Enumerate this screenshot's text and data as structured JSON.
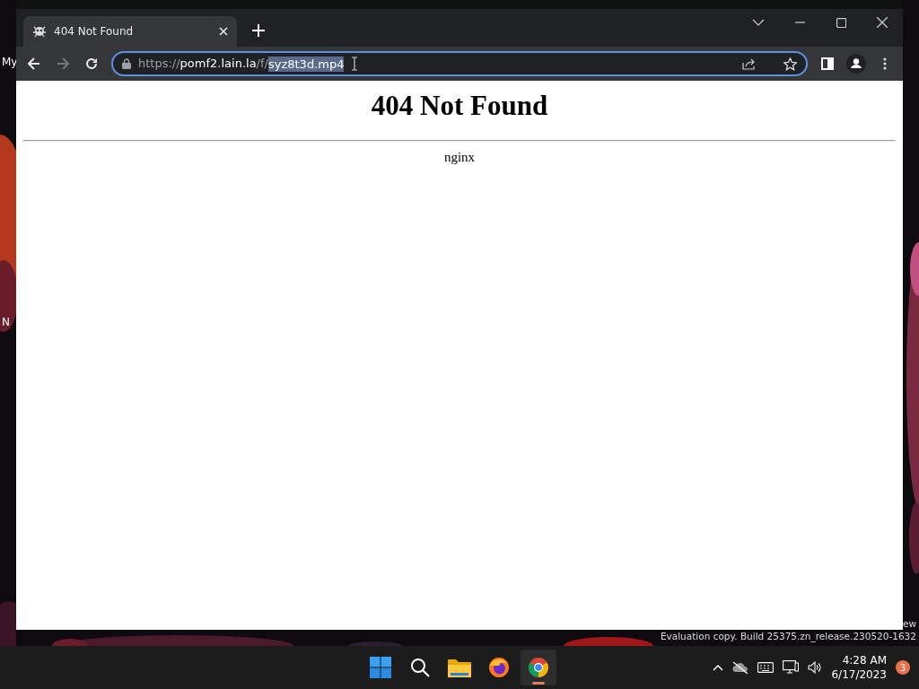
{
  "desktop": {
    "icon_labels": [
      {
        "text": "My"
      },
      {
        "text": "N"
      }
    ],
    "build_notice": {
      "line_1": "ew",
      "line_2": "Evaluation copy. Build 25375.zn_release.230520-1632"
    }
  },
  "browser": {
    "tabs": [
      {
        "title": "404 Not Found",
        "selected": true
      }
    ],
    "address": {
      "segments": [
        {
          "text": "https://",
          "kind": "dim",
          "selected": false
        },
        {
          "text": "pomf2.lain.la",
          "kind": "host",
          "selected": false
        },
        {
          "text": "/f/",
          "kind": "dim",
          "selected": false
        },
        {
          "text": "syz8t3d.mp4",
          "kind": "dim",
          "selected": true
        }
      ],
      "focused": true
    },
    "nav": {
      "back_disabled": false,
      "forward_disabled": true
    },
    "page": {
      "heading": "404 Not Found",
      "footer": "nginx"
    }
  },
  "taskbar": {
    "apps": [
      {
        "kind": "start",
        "selected": false
      },
      {
        "kind": "search",
        "selected": false
      },
      {
        "kind": "files",
        "selected": false
      },
      {
        "kind": "firefox",
        "selected": false
      },
      {
        "kind": "chrome",
        "selected": true
      }
    ],
    "clock": {
      "time": "4:28 AM",
      "date": "6/17/2023"
    },
    "notifications": "3"
  }
}
